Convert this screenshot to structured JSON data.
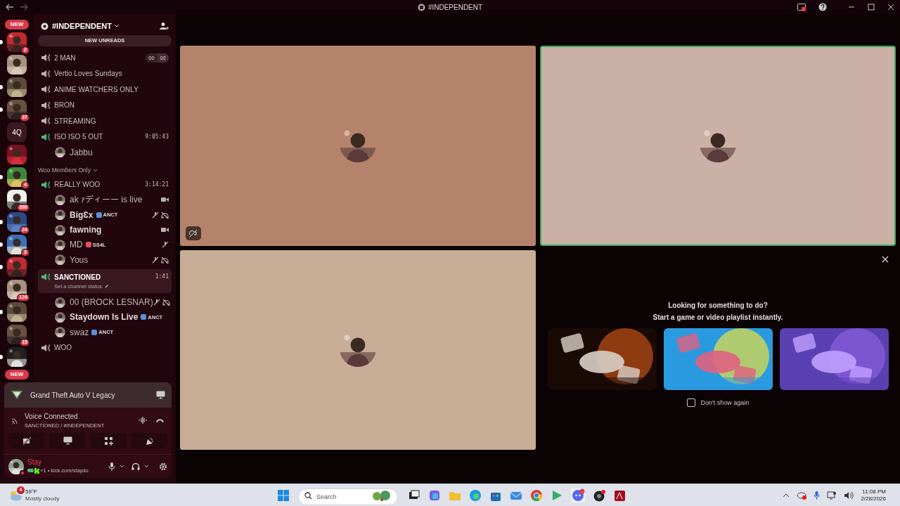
{
  "title_bar": {
    "title": "#INDEPENDENT"
  },
  "servers": [
    {
      "kind": "pill",
      "label": "NEW"
    },
    {
      "kind": "picture",
      "badge": "2",
      "unread": true
    },
    {
      "kind": "picture",
      "unread": false
    },
    {
      "kind": "picture",
      "unread": true
    },
    {
      "kind": "picture",
      "badge": "37",
      "unread": true
    },
    {
      "kind": "text",
      "label": "4Q",
      "unread": false
    },
    {
      "kind": "picture",
      "unread": false
    },
    {
      "kind": "picture",
      "badge": "4",
      "unread": true
    },
    {
      "kind": "picture",
      "badge": "380",
      "unread": false
    },
    {
      "kind": "picture",
      "badge": "24",
      "unread": true
    },
    {
      "kind": "picture",
      "badge": "3",
      "unread": true
    },
    {
      "kind": "picture",
      "unread": true
    },
    {
      "kind": "picture",
      "badge": "124",
      "unread": false
    },
    {
      "kind": "picture",
      "unread": true
    },
    {
      "kind": "picture",
      "badge": "15",
      "unread": false
    },
    {
      "kind": "picture",
      "unread": true
    },
    {
      "kind": "pill",
      "label": "NEW"
    }
  ],
  "server_header": {
    "name": "#INDEPENDENT"
  },
  "new_unreads": "NEW UNREADS",
  "channel_list": [
    {
      "kind": "channel",
      "name": "2 MAN",
      "active": false,
      "selected": false,
      "counter": [
        "00",
        "02"
      ]
    },
    {
      "kind": "channel",
      "name": "Vertio Loves Sundays",
      "active": false,
      "selected": false
    },
    {
      "kind": "channel",
      "name": "ANIME WATCHERS ONLY",
      "active": false,
      "selected": false
    },
    {
      "kind": "channel",
      "name": "BRON",
      "active": false,
      "selected": false
    },
    {
      "kind": "channel",
      "name": "STREAMING",
      "active": false,
      "selected": false
    },
    {
      "kind": "channel",
      "name": "ISO ISO 5 OUT",
      "active": true,
      "selected": false,
      "timer": "9:05:43"
    },
    {
      "kind": "user",
      "name": "Jabbu",
      "bold": false,
      "video": false,
      "muted": false,
      "deafened": false
    },
    {
      "kind": "category",
      "name": "Woo Members Only"
    },
    {
      "kind": "channel",
      "name": "REALLY WOO",
      "active": true,
      "selected": false,
      "timer": "3:14:21"
    },
    {
      "kind": "user",
      "name": "ak ｧディーー is live",
      "bold": false,
      "video": true,
      "muted": false,
      "deafened": false
    },
    {
      "kind": "user",
      "name": "BigƐx",
      "bold": true,
      "tag": {
        "text": "ANCT",
        "color": "#5b8fd9"
      },
      "video": false,
      "muted": true,
      "deafened": true
    },
    {
      "kind": "user",
      "name": "fawning",
      "bold": true,
      "video": true,
      "muted": false,
      "deafened": false
    },
    {
      "kind": "user",
      "name": "MD",
      "bold": false,
      "tag": {
        "text": "SS4L",
        "color": "#e0525f"
      },
      "video": false,
      "muted": true,
      "deafened": false
    },
    {
      "kind": "user",
      "name": "Yous",
      "bold": false,
      "video": false,
      "muted": true,
      "deafened": true
    },
    {
      "kind": "channel",
      "name": "SANCTIONED",
      "active": true,
      "selected": true,
      "timer": "1:41",
      "status": "Set a channel status"
    },
    {
      "kind": "user",
      "name": "00 (BROCK LESNAR)",
      "bold": false,
      "video": false,
      "muted": true,
      "deafened": true
    },
    {
      "kind": "user",
      "name": "Staydown Is Live",
      "bold": true,
      "tag": {
        "text": "ANCT",
        "color": "#5b8fd9"
      },
      "video": false,
      "muted": false,
      "deafened": false
    },
    {
      "kind": "user",
      "name": "swaz",
      "bold": false,
      "tag": {
        "text": "ANCT",
        "color": "#5b8fd9"
      },
      "video": false,
      "muted": false,
      "deafened": false
    },
    {
      "kind": "channel",
      "name": "WOO",
      "active": false,
      "selected": false
    }
  ],
  "game_activity": {
    "name": "Grand Theft Auto V Legacy"
  },
  "voice": {
    "status": "Voice Connected",
    "location": "SANCTIONED / #INDEPENDENT"
  },
  "user_panel": {
    "name": "Stay",
    "activity": "+1 • kick.com/staydo"
  },
  "tiles": [
    {
      "color": "#b5836b",
      "selected": false,
      "stream_muted": true
    },
    {
      "color": "#cbb0a6",
      "selected": true,
      "stream_muted": false
    },
    {
      "color": "#c7ad95",
      "selected": false,
      "stream_muted": false
    }
  ],
  "activity_panel": {
    "heading": "Looking for something to do?",
    "subheading": "Start a game or video playlist instantly.",
    "cards": [
      {
        "kind": "picture"
      },
      {
        "kind": "picture"
      },
      {
        "kind": "picture"
      }
    ],
    "dont_show_again": {
      "label": "Don't show again",
      "checked": false
    }
  },
  "taskbar": {
    "weather_badge": "4",
    "temperature": "59°F",
    "weather": "Mostly cloudy",
    "search_placeholder": "Search",
    "time": "11:08 PM",
    "date": "2/28/2026"
  }
}
